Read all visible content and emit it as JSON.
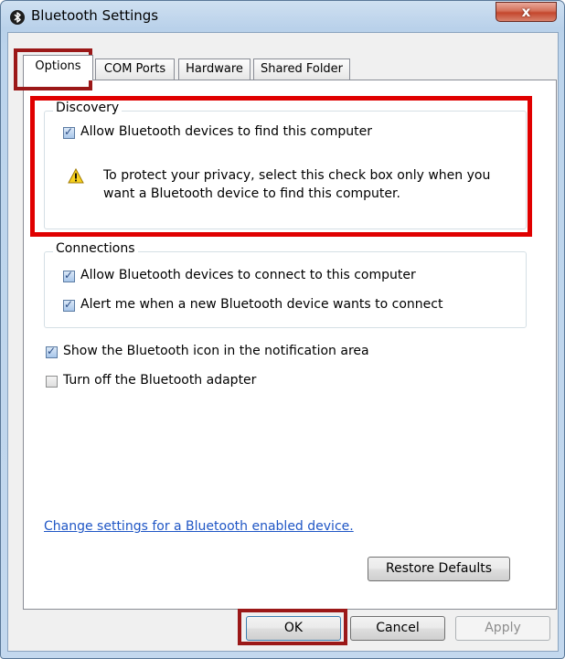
{
  "window": {
    "title": "Bluetooth Settings",
    "close_label": "x"
  },
  "tabs": [
    {
      "label": "Options",
      "selected": true
    },
    {
      "label": "COM Ports",
      "selected": false
    },
    {
      "label": "Hardware",
      "selected": false
    },
    {
      "label": "Shared Folder",
      "selected": false
    }
  ],
  "discovery": {
    "label": "Discovery",
    "allow_find_label": "Allow Bluetooth devices to find this computer",
    "allow_find_checked": true,
    "warning": "To protect your privacy, select this check box only when you want a Bluetooth device to find this computer."
  },
  "connections": {
    "label": "Connections",
    "allow_connect_label": "Allow Bluetooth devices to connect to this computer",
    "allow_connect_checked": true,
    "alert_label": "Alert me when a new Bluetooth device wants to connect",
    "alert_checked": true
  },
  "options": {
    "show_icon_label": "Show the Bluetooth icon in the notification area",
    "show_icon_checked": true,
    "turn_off_label": "Turn off the Bluetooth adapter",
    "turn_off_checked": false
  },
  "link": "Change settings for a Bluetooth enabled device.",
  "buttons": {
    "restore": "Restore Defaults",
    "ok": "OK",
    "cancel": "Cancel",
    "apply": "Apply",
    "apply_enabled": false
  },
  "colors": {
    "highlight": "#e00000",
    "highlight_dark": "#9b1818",
    "link": "#1f56c5"
  },
  "icons": {
    "app": "bluetooth-icon",
    "warning": "warning-icon"
  }
}
